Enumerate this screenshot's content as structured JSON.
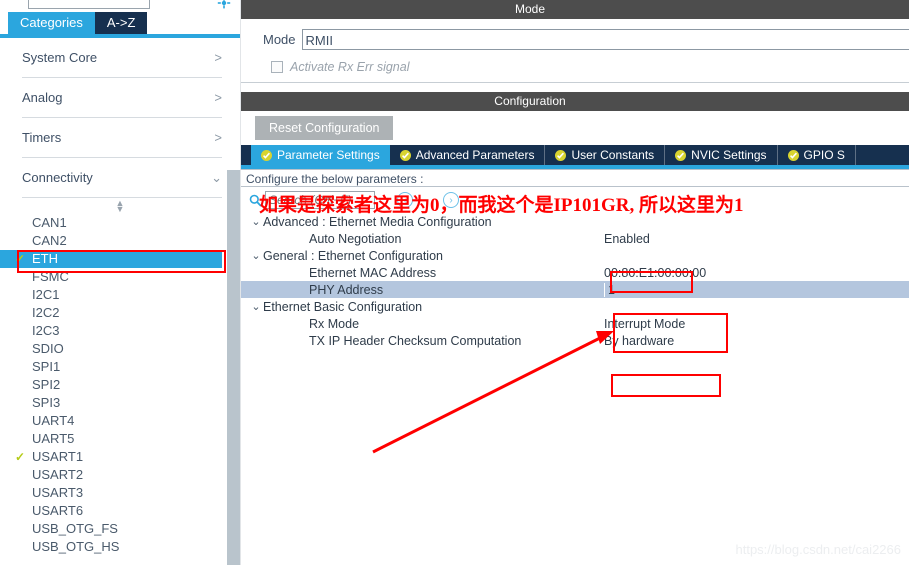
{
  "sidebar": {
    "search_placeholder": "",
    "gear_icon": "gear-icon",
    "tabs": [
      {
        "label": "Categories",
        "active": true
      },
      {
        "label": "A->Z",
        "active": false
      }
    ],
    "categories": [
      {
        "label": "System Core",
        "chevron": ">"
      },
      {
        "label": "Analog",
        "chevron": ">"
      },
      {
        "label": "Timers",
        "chevron": ">"
      },
      {
        "label": "Connectivity",
        "chevron": "v"
      }
    ],
    "peripherals": [
      {
        "label": "CAN1",
        "state": "none"
      },
      {
        "label": "CAN2",
        "state": "none"
      },
      {
        "label": "ETH",
        "state": "checked",
        "selected": true
      },
      {
        "label": "FSMC",
        "state": "none"
      },
      {
        "label": "I2C1",
        "state": "none"
      },
      {
        "label": "I2C2",
        "state": "none"
      },
      {
        "label": "I2C3",
        "state": "none"
      },
      {
        "label": "SDIO",
        "state": "none"
      },
      {
        "label": "SPI1",
        "state": "none"
      },
      {
        "label": "SPI2",
        "state": "none"
      },
      {
        "label": "SPI3",
        "state": "none"
      },
      {
        "label": "UART4",
        "state": "none"
      },
      {
        "label": "UART5",
        "state": "none"
      },
      {
        "label": "USART1",
        "state": "checked"
      },
      {
        "label": "USART2",
        "state": "none"
      },
      {
        "label": "USART3",
        "state": "none"
      },
      {
        "label": "USART6",
        "state": "none"
      },
      {
        "label": "USB_OTG_FS",
        "state": "none"
      },
      {
        "label": "USB_OTG_HS",
        "state": "none"
      }
    ]
  },
  "mode_panel": {
    "header": "Mode",
    "mode_label": "Mode",
    "mode_value": "RMII",
    "rx_err_label": "Activate Rx Err signal",
    "rx_err_checked": false
  },
  "configuration": {
    "header": "Configuration",
    "reset_button": "Reset Configuration",
    "tabs": [
      {
        "label": "Parameter Settings",
        "active": true
      },
      {
        "label": "Advanced Parameters",
        "active": false
      },
      {
        "label": "User Constants",
        "active": false
      },
      {
        "label": "NVIC Settings",
        "active": false
      },
      {
        "label": "GPIO S",
        "active": false
      }
    ],
    "hint": "Configure the below parameters :",
    "search_placeholder": "Search (Crtl+F)",
    "search_value": "",
    "prev_label": "‹",
    "next_label": "›",
    "tree": [
      {
        "type": "group",
        "name": "Advanced : Ethernet Media Configuration",
        "value": "",
        "twisty": "v"
      },
      {
        "type": "leaf",
        "name": "Auto Negotiation",
        "value": "Enabled"
      },
      {
        "type": "group",
        "name": "General : Ethernet Configuration",
        "value": "",
        "twisty": "v"
      },
      {
        "type": "leaf",
        "name": "Ethernet MAC Address",
        "value": "00:80:E1:00:00:00"
      },
      {
        "type": "leaf",
        "name": "PHY Address",
        "value": "1",
        "highlight": true,
        "editing": true
      },
      {
        "type": "group",
        "name": "Ethernet Basic Configuration",
        "value": "",
        "twisty": "v"
      },
      {
        "type": "leaf",
        "name": "Rx Mode",
        "value": "Interrupt Mode"
      },
      {
        "type": "leaf",
        "name": "TX IP Header Checksum Computation",
        "value": "By hardware"
      }
    ]
  },
  "annotations": {
    "note_text": "如果是探索者这里为0，而我这个是IP101GR, 所以这里为1",
    "highlight_color": "#ff0000"
  },
  "watermark": "https://blog.csdn.net/cai2266"
}
